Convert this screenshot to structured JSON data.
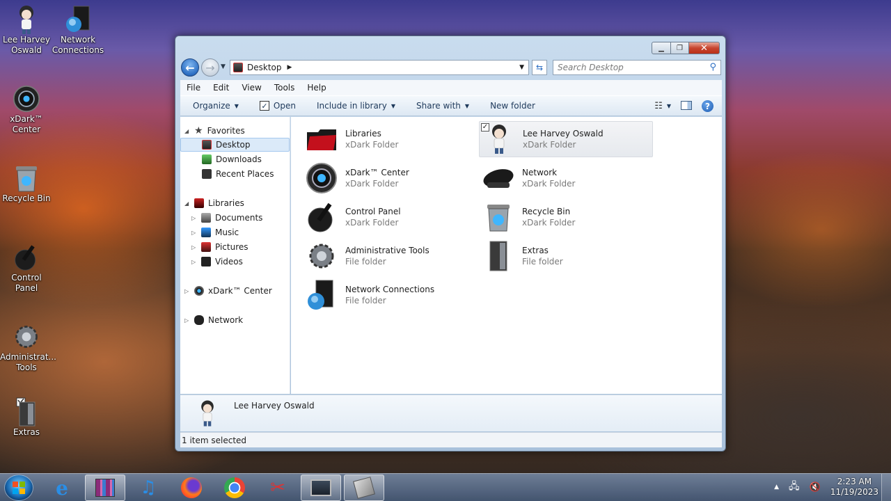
{
  "desktop": {
    "icons": [
      {
        "label": "Lee Harvey Oswald",
        "icon": "anime-user-icon"
      },
      {
        "label": "Network Connections",
        "icon": "network-connections-icon"
      },
      {
        "label": "xDark™ Center",
        "icon": "xdark-center-icon"
      },
      {
        "label": "Recycle Bin",
        "icon": "recycle-bin-icon"
      },
      {
        "label": "Control Panel",
        "icon": "control-panel-icon"
      },
      {
        "label": "Administrat... Tools",
        "icon": "administrative-tools-icon"
      },
      {
        "label": "Extras",
        "icon": "extras-folder-icon"
      }
    ]
  },
  "window": {
    "address": {
      "location": "Desktop"
    },
    "search": {
      "placeholder": "Search Desktop"
    },
    "menu": [
      "File",
      "Edit",
      "View",
      "Tools",
      "Help"
    ],
    "commands": {
      "organize": "Organize",
      "open": "Open",
      "include_in_library": "Include in library",
      "share_with": "Share with",
      "new_folder": "New folder"
    },
    "nav": {
      "favorites": "Favorites",
      "desktop": "Desktop",
      "downloads": "Downloads",
      "recent_places": "Recent Places",
      "libraries": "Libraries",
      "documents": "Documents",
      "music": "Music",
      "pictures": "Pictures",
      "videos": "Videos",
      "xdark_center": "xDark™ Center",
      "network": "Network"
    },
    "items": [
      {
        "name": "Libraries",
        "type": "xDark Folder"
      },
      {
        "name": "Lee Harvey Oswald",
        "type": "xDark Folder"
      },
      {
        "name": "xDark™ Center",
        "type": "xDark Folder"
      },
      {
        "name": "Network",
        "type": "xDark Folder"
      },
      {
        "name": "Control Panel",
        "type": "xDark Folder"
      },
      {
        "name": "Recycle Bin",
        "type": "xDark Folder"
      },
      {
        "name": "Administrative Tools",
        "type": "File folder"
      },
      {
        "name": "Extras",
        "type": "File folder"
      },
      {
        "name": "Network Connections",
        "type": "File folder"
      }
    ],
    "details": {
      "name": "Lee Harvey Oswald"
    },
    "status": "1 item selected"
  },
  "taskbar": {
    "apps": [
      "internet-explorer-icon",
      "winrar-icon",
      "itunes-icon",
      "firefox-icon",
      "chrome-icon",
      "tools-icon",
      "monitor-icon",
      "xdark-icon"
    ],
    "clock": {
      "time": "2:23 AM",
      "date": "11/19/2023"
    }
  }
}
